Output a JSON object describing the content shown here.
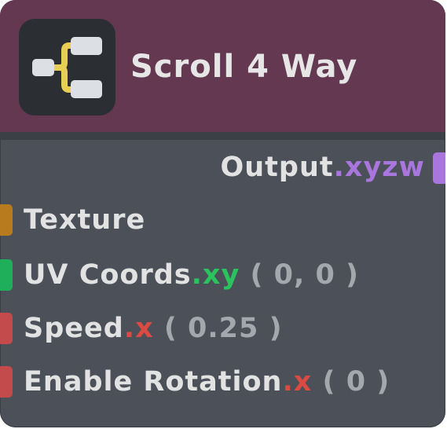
{
  "node": {
    "title": "Scroll 4 Way",
    "icon": "branch-connector-icon",
    "colors": {
      "header": "#653852",
      "body": "#4b5059",
      "icon_accent": "#e8cf54",
      "texture": "#b87b1e",
      "vector2": "#1fae59",
      "float": "#c44b4b",
      "vector4": "#a976dd"
    }
  },
  "outputs": [
    {
      "name": "Output",
      "swizzle": ".xyzw"
    }
  ],
  "inputs": [
    {
      "name": "Texture",
      "swizzle": "",
      "default": ""
    },
    {
      "name": "UV Coords",
      "swizzle": ".xy",
      "default": " ( 0, 0 )"
    },
    {
      "name": "Speed",
      "swizzle": ".x",
      "default": " ( 0.25 )"
    },
    {
      "name": "Enable Rotation",
      "swizzle": ".x",
      "default": " ( 0 )"
    }
  ]
}
